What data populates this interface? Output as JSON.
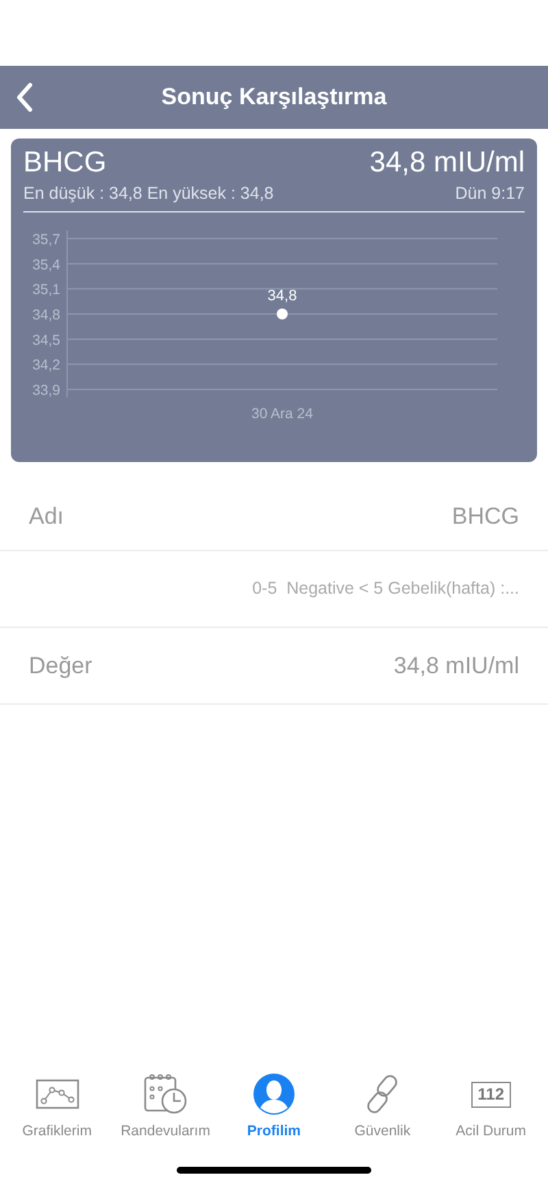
{
  "header": {
    "title": "Sonuç Karşılaştırma"
  },
  "card": {
    "test_name": "BHCG",
    "value": "34,8 mIU/ml",
    "range": "En düşük : 34,8 En yüksek : 34,8",
    "time": "Dün 9:17",
    "chart_data": {
      "type": "scatter",
      "categories": [
        "30 Ara 24"
      ],
      "series": [
        {
          "color": "#ffffff",
          "values": [
            34.8
          ]
        }
      ],
      "grid": true,
      "ylim": [
        33.9,
        35.7
      ],
      "yticks": [
        {
          "value": 35.7,
          "label": "35,7"
        },
        {
          "value": 35.4,
          "label": "35,4"
        },
        {
          "value": 35.1,
          "label": "35,1"
        },
        {
          "value": 34.8,
          "label": "34,8"
        },
        {
          "value": 34.5,
          "label": "34,5"
        },
        {
          "value": 34.2,
          "label": "34,2"
        },
        {
          "value": 33.9,
          "label": "33,9"
        }
      ],
      "value_labels": [
        "34,8"
      ]
    }
  },
  "details": [
    {
      "label": "Adı",
      "value": "BHCG"
    },
    {
      "value": "0-5  Negative < 5 Gebelik(hafta) :..."
    },
    {
      "label": "Değer",
      "value": "34,8 mIU/ml"
    }
  ],
  "tab_bar": [
    {
      "label": "Grafiklerim",
      "selected": false
    },
    {
      "label": "Randevularım",
      "selected": false
    },
    {
      "label": "Profilim",
      "selected": true
    },
    {
      "label": "Güvenlik",
      "selected": false
    },
    {
      "label": "Acil Durum",
      "selected": false,
      "icon_text": "112"
    }
  ]
}
